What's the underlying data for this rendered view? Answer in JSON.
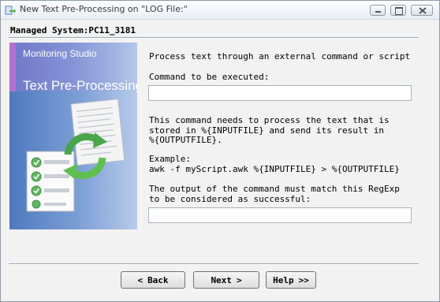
{
  "window": {
    "title": "New Text Pre-Processing on \"LOG File:\"",
    "controls": [
      "minimize",
      "maximize",
      "close"
    ]
  },
  "header": {
    "managed_system": "Managed System:PC11_3181"
  },
  "side_panel": {
    "subtitle": "Monitoring Studio",
    "title": "Text Pre-Processing",
    "colors": {
      "gradient_start": "#4f79bf",
      "gradient_end": "#b8cbea",
      "accent": "#b46fd0"
    }
  },
  "content": {
    "heading": "Process text through an external command or script",
    "command_label": "Command to be executed:",
    "command_value": "",
    "description": "This command needs to process the text that is\nstored in %{INPUTFILE} and send its result in\n%{OUTPUTFILE}.",
    "example_label": "Example:",
    "example_code": "awk -f myScript.awk %{INPUTFILE} > %{OUTPUTFILE}",
    "regex_label": "The output of the command must match this RegExp\nto be considered as successful:",
    "regex_value": ""
  },
  "buttons": {
    "back": {
      "arrow": "<",
      "label": "Back"
    },
    "next": {
      "label": "Next",
      "arrow": ">"
    },
    "help": {
      "label": "Help",
      "arrow": ">>"
    }
  }
}
